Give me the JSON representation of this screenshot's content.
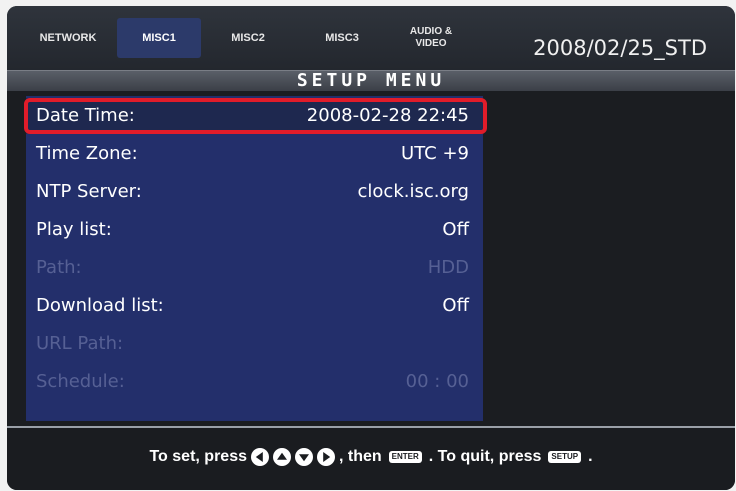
{
  "tabs": [
    {
      "label": "NETWORK",
      "active": false
    },
    {
      "label": "MISC1",
      "active": true
    },
    {
      "label": "MISC2",
      "active": false
    },
    {
      "label": "MISC3",
      "active": false
    },
    {
      "label": "AUDIO &\nVIDEO",
      "active": false
    }
  ],
  "header": {
    "date_std": "2008/02/25_STD",
    "title": "SETUP MENU"
  },
  "menu": {
    "items": [
      {
        "label": "Date Time:",
        "value": "2008-02-28 22:45",
        "enabled": true,
        "selected": true
      },
      {
        "label": "Time Zone:",
        "value": "UTC +9",
        "enabled": true
      },
      {
        "label": "NTP Server:",
        "value": "clock.isc.org",
        "enabled": true
      },
      {
        "label": "Play list:",
        "value": "Off",
        "enabled": true
      },
      {
        "label": "Path:",
        "value": "HDD",
        "enabled": false
      },
      {
        "label": "Download list:",
        "value": "Off",
        "enabled": true
      },
      {
        "label": "URL Path:",
        "value": "",
        "enabled": false
      },
      {
        "label": "Schedule:",
        "value": "00 : 00",
        "enabled": false
      }
    ]
  },
  "footer": {
    "prefix": "To set, press",
    "middle": ", then",
    "enter_key": "ENTER",
    "suffix": ". To quit, press",
    "setup_key": "SETUP",
    "end": "."
  },
  "colors": {
    "panel": "#232f6b",
    "highlight": "#e11c2a",
    "disabled_text": "#566094"
  }
}
